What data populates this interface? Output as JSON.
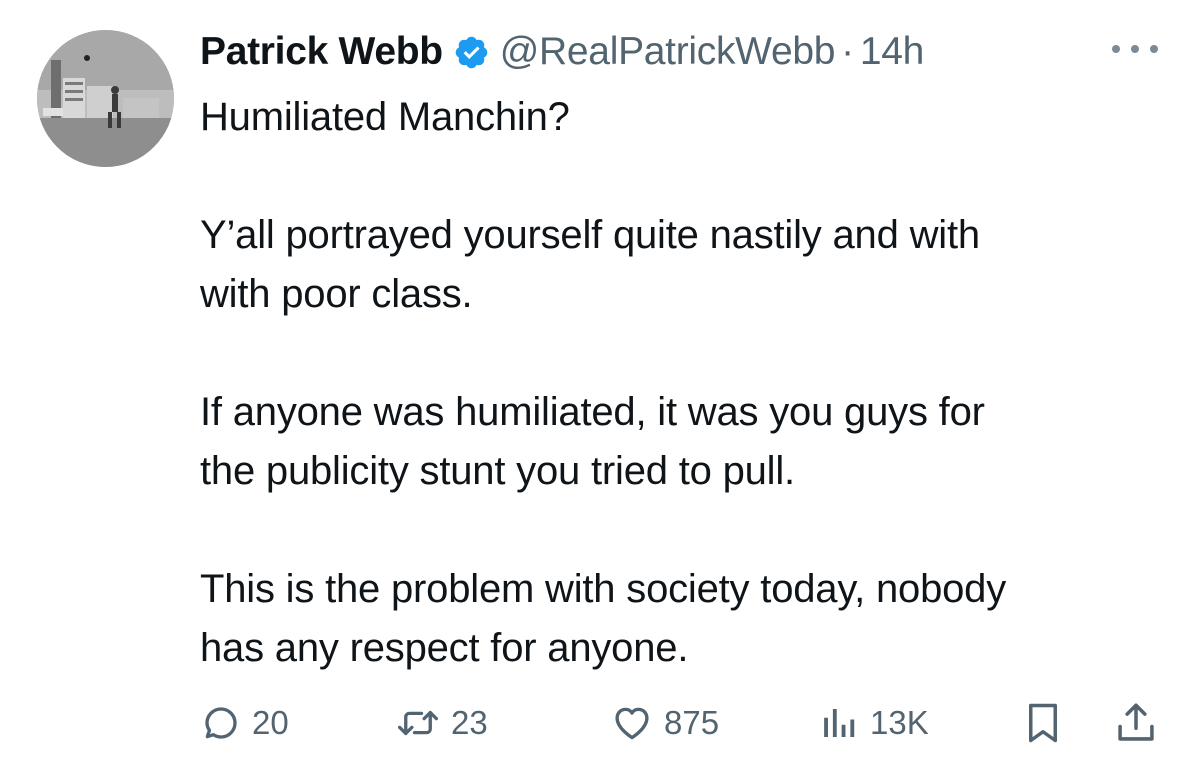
{
  "tweet": {
    "author_name": "Patrick Webb",
    "verified_icon": "verified-badge-icon",
    "handle": "@RealPatrickWebb",
    "separator": "·",
    "time": "14h",
    "paragraphs": [
      "Humiliated Manchin?",
      "Y’all portrayed yourself quite nastily and with\nwith poor class.",
      "If anyone was humiliated, it was you guys for\nthe publicity stunt you tried to pull.",
      "This is the problem with society today, nobody\nhas any respect for anyone."
    ],
    "stats": {
      "replies": "20",
      "retweets": "23",
      "likes": "875",
      "views": "13K"
    }
  },
  "colors": {
    "text": "#0f1419",
    "secondary": "#536471",
    "verified": "#1d9bf0"
  }
}
